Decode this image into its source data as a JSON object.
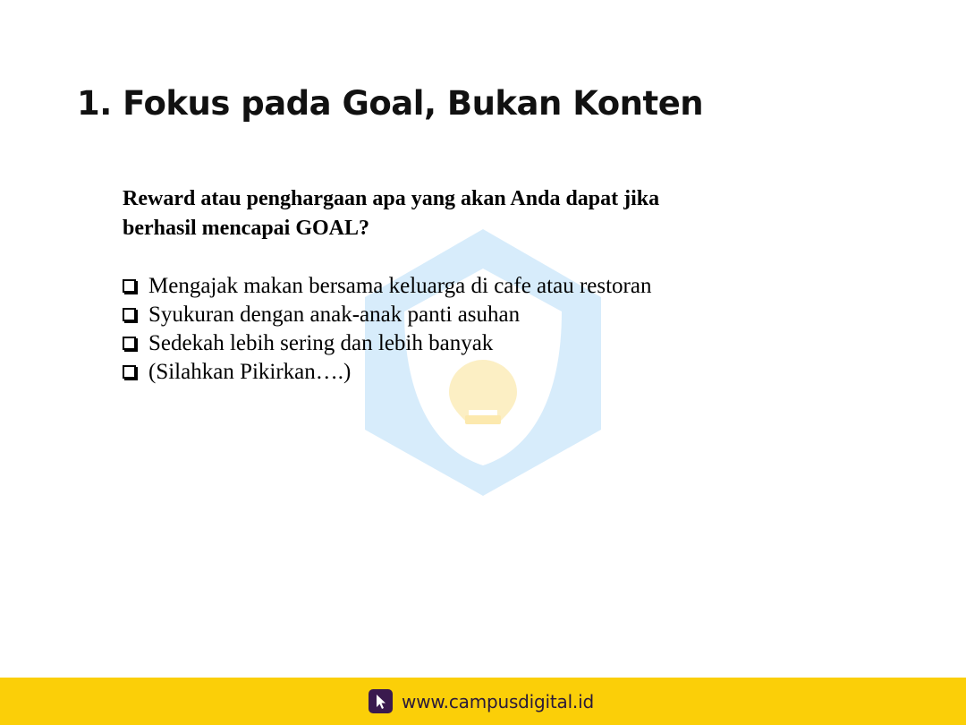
{
  "slide": {
    "title": "1. Fokus pada Goal, Bukan Konten",
    "question_lines": [
      "Reward atau penghargaan apa yang akan Anda dapat jika",
      "berhasil mencapai GOAL?"
    ],
    "rewards": [
      "Mengajak makan bersama keluarga di cafe atau restoran",
      "Syukuran dengan anak-anak panti asuhan",
      "Sedekah lebih sering dan lebih banyak",
      "(Silahkan Pikirkan….)"
    ]
  },
  "footer": {
    "url": "www.campusdigital.id",
    "icon": "cursor-pointer-icon"
  },
  "colors": {
    "footer_bg": "#fbcf08",
    "watermark_blue": "#4aa8e8",
    "watermark_yellow": "#f5c518"
  }
}
